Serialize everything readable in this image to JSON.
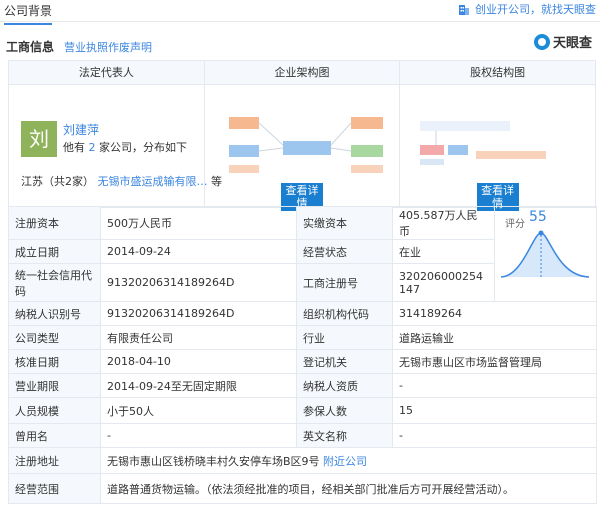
{
  "header": {
    "title": "公司背景",
    "promo_text": "创业开公司，就找天眼查"
  },
  "subnav": {
    "active": "工商信息",
    "link": "营业执照作废声明"
  },
  "logo": {
    "text": "天眼查"
  },
  "panel": {
    "headers": [
      "法定代表人",
      "企业架构图",
      "股权结构图"
    ],
    "rep": {
      "avatar_char": "刘",
      "name": "刘建萍",
      "line_prefix": "他有 ",
      "count": "2",
      "line_suffix": " 家公司，分布如下",
      "more_region": "江苏（共2家）",
      "more_company": "无锡市盛运成输有限…",
      "more_etc": "等"
    },
    "view_button": "查看详情"
  },
  "info": {
    "rows": [
      {
        "l1": "注册资本",
        "v1": "500万人民币",
        "l2": "实缴资本",
        "v2": "405.587万人民币"
      },
      {
        "l1": "成立日期",
        "v1": "2014-09-24",
        "l2": "经营状态",
        "v2": "在业"
      },
      {
        "l1": "统一社会信用代码",
        "v1": "91320206314189264D",
        "l2": "工商注册号",
        "v2": "320206000254147"
      },
      {
        "l1": "纳税人识别号",
        "v1": "91320206314189264D",
        "l2": "组织机构代码",
        "v2": "314189264"
      },
      {
        "l1": "公司类型",
        "v1": "有限责任公司",
        "l2": "行业",
        "v2": "道路运输业"
      },
      {
        "l1": "核准日期",
        "v1": "2018-04-10",
        "l2": "登记机关",
        "v2": "无锡市惠山区市场监督管理局"
      },
      {
        "l1": "营业期限",
        "v1": "2014-09-24至无固定期限",
        "l2": "纳税人资质",
        "v2": "-"
      },
      {
        "l1": "人员规模",
        "v1": "小于50人",
        "l2": "参保人数",
        "v2": "15"
      },
      {
        "l1": "曾用名",
        "v1": "-",
        "l2": "英文名称",
        "v2": "-"
      }
    ],
    "address_label": "注册地址",
    "address_value": "无锡市惠山区钱桥晓丰村久安停车场B区9号",
    "address_link": "附近公司",
    "scope_label": "经营范围",
    "scope_value": "道路普通货物运输。（依法须经批准的项目，经相关部门批准后方可开展经营活动）。",
    "score_label": "评分",
    "score_value": "55"
  },
  "colors": {
    "accent": "#3b86e0",
    "button": "#1a7fd0",
    "avatar": "#8fb35a"
  }
}
